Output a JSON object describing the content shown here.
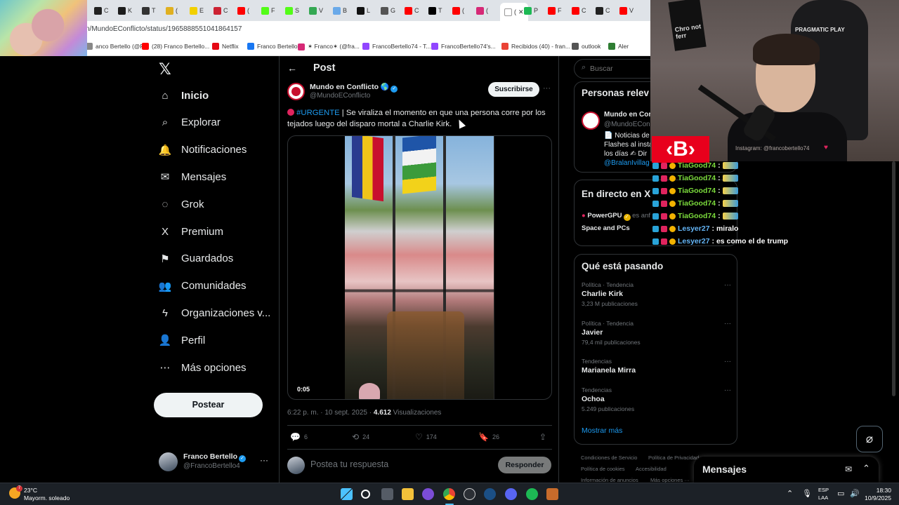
{
  "browser": {
    "url": "n/MundoEConflicto/status/1965888551041864157",
    "tabs": [
      {
        "label": "C",
        "color": "#222222"
      },
      {
        "label": "K",
        "color": "#1c1c1c"
      },
      {
        "label": "T",
        "color": "#333333"
      },
      {
        "label": "(",
        "color": "#e0b020"
      },
      {
        "label": "E",
        "color": "#f2d000"
      },
      {
        "label": "C",
        "color": "#cc2233"
      },
      {
        "label": "(",
        "color": "#ff0000"
      },
      {
        "label": "F",
        "color": "#53fc18"
      },
      {
        "label": "S",
        "color": "#53fc18"
      },
      {
        "label": "V",
        "color": "#34a853"
      },
      {
        "label": "B",
        "color": "#6aa9e9"
      },
      {
        "label": "L",
        "color": "#111111"
      },
      {
        "label": "G",
        "color": "#555555"
      },
      {
        "label": "C",
        "color": "#ff0000"
      },
      {
        "label": "T",
        "color": "#000000"
      },
      {
        "label": "(",
        "color": "#ff0000"
      },
      {
        "label": "(",
        "color": "#d62976"
      },
      {
        "label": "(",
        "color": "#ffffff"
      },
      {
        "label": "P",
        "color": "#1db954"
      },
      {
        "label": "F",
        "color": "#ff0000"
      },
      {
        "label": "C",
        "color": "#ff0000"
      },
      {
        "label": "C",
        "color": "#222222"
      },
      {
        "label": "V",
        "color": "#ff0000"
      }
    ],
    "bookmarks": [
      {
        "label": "anco Bertello (@F...",
        "color": "#888888"
      },
      {
        "label": "(28) Franco Bertello...",
        "color": "#ff0000"
      },
      {
        "label": "Netflix",
        "color": "#e50914"
      },
      {
        "label": "Franco Bertello",
        "color": "#1877f2"
      },
      {
        "label": "✶ Franco✶ (@fra...",
        "color": "#d62976"
      },
      {
        "label": "FrancoBertello74 - T...",
        "color": "#9146ff"
      },
      {
        "label": "FrancoBertello74's...",
        "color": "#9146ff"
      },
      {
        "label": "Recibidos (40) - fran...",
        "color": "#ea4335"
      },
      {
        "label": "outlook",
        "color": "#555555"
      },
      {
        "label": "Aler",
        "color": "#2e7d32"
      }
    ]
  },
  "sidebar": {
    "items": [
      {
        "label": "Inicio",
        "icon": "⌂"
      },
      {
        "label": "Explorar",
        "icon": "⌕"
      },
      {
        "label": "Notificaciones",
        "icon": "🔔"
      },
      {
        "label": "Mensajes",
        "icon": "✉"
      },
      {
        "label": "Grok",
        "icon": "◌"
      },
      {
        "label": "Premium",
        "icon": "X"
      },
      {
        "label": "Guardados",
        "icon": "⚑"
      },
      {
        "label": "Comunidades",
        "icon": "👥"
      },
      {
        "label": "Organizaciones v...",
        "icon": "ϟ"
      },
      {
        "label": "Perfil",
        "icon": "👤"
      },
      {
        "label": "Más opciones",
        "icon": "⋯"
      }
    ],
    "notification_count": "1",
    "post_button": "Postear",
    "account": {
      "name": "Franco Bertello",
      "handle": "@FrancoBertello4"
    }
  },
  "post": {
    "header_title": "Post",
    "author_name": "Mundo en Conflicto",
    "author_handle": "@MundoEConflicto",
    "subscribe_label": "Suscribirse",
    "text_tag": "#URGENTE",
    "text_body": " | Se viraliza el momento en que una persona corre por los tejados luego del disparo mortal a Charlie Kirk.",
    "video_time": "0:05",
    "timestamp": "6:22 p. m. · 10 sept. 2025 · ",
    "views_count": "4.612",
    "views_label": "Visualizaciones",
    "replies": "6",
    "reposts": "24",
    "likes": "174",
    "bookmarks": "26",
    "reply_placeholder": "Postea tu respuesta",
    "reply_button": "Responder"
  },
  "right": {
    "search_placeholder": "Buscar",
    "relevant_title": "Personas relev",
    "relevant_name": "Mundo en Cor",
    "relevant_handle": "@MundoECon",
    "relevant_bio1": "📄 Noticias de",
    "relevant_bio2": "Flashes al insta",
    "relevant_bio3": "los días ✍ Dir",
    "relevant_bio4": "@BralanIvillag",
    "live_title": "En directo en X",
    "live_host": "PowerGPU",
    "live_host_suffix": " es anf",
    "live_space": "Space and PCs",
    "trending_title": "Qué está pasando",
    "trends": [
      {
        "category": "Política · Tendencia",
        "name": "Charlie Kirk",
        "count": "3,23 M publicaciones"
      },
      {
        "category": "Política · Tendencia",
        "name": "Javier",
        "count": "79,4 mil publicaciones"
      },
      {
        "category": "Tendencias",
        "name": "Marianela Mirra",
        "count": ""
      },
      {
        "category": "Tendencias",
        "name": "Ochoa",
        "count": "5.249 publicaciones"
      }
    ],
    "show_more": "Mostrar más",
    "footer": [
      "Condiciones de Servicio",
      "Política de Privacidad",
      "Política de cookies",
      "Accesibilidad",
      "Información de anuncios",
      "Más opciones ···"
    ],
    "messages_title": "Mensajes"
  },
  "stream": {
    "instagram": "Instagram: @francobertello74",
    "chair_brand": "PRAGMATIC PLAY",
    "poster_text": "Chro not ferr",
    "chat": [
      {
        "user": "TiaGood74",
        "msg": ":",
        "emote": true
      },
      {
        "user": "TiaGood74",
        "msg": ":",
        "emote": true
      },
      {
        "user": "TiaGood74",
        "msg": ":",
        "emote": true
      },
      {
        "user": "TiaGood74",
        "msg": ":",
        "emote": true
      },
      {
        "user": "TiaGood74",
        "msg": ":",
        "emote": true
      },
      {
        "user": "Lesyer27",
        "msg": ": miralo",
        "emote": false
      },
      {
        "user": "Lesyer27",
        "msg": ": es como el de trump",
        "emote": false
      }
    ]
  },
  "taskbar": {
    "weather_badge": "7",
    "temperature": "23°C",
    "weather": "Mayorm. soleado",
    "lang1": "ESP",
    "lang2": "LAA",
    "time": "18:30",
    "date": "10/9/2025"
  }
}
